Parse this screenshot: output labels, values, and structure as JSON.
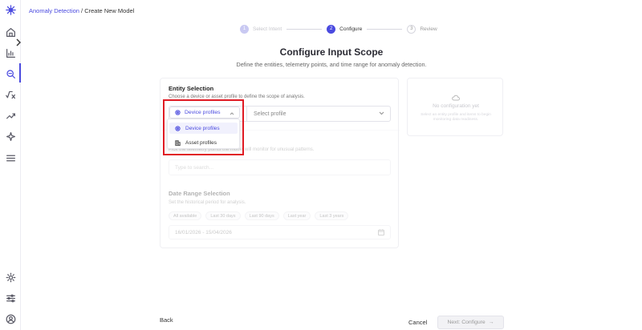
{
  "breadcrumb": {
    "parent": "Anomaly Detection",
    "separator": " / ",
    "current": "Create New Model"
  },
  "stepper": {
    "steps": [
      {
        "num": "1",
        "label": "Select Intent"
      },
      {
        "num": "2",
        "label": "Configure"
      },
      {
        "num": "3",
        "label": "Review"
      }
    ]
  },
  "header": {
    "title": "Configure Input Scope",
    "subtitle": "Define the entities, telemetry points, and time range for anomaly detection."
  },
  "entity": {
    "title": "Entity Selection",
    "description": "Choose a device or asset profile to define the scope of analysis.",
    "type_selected": "Device profiles",
    "profile_placeholder": "Select profile",
    "options": [
      "Device profiles",
      "Asset profiles"
    ]
  },
  "telemetry": {
    "description": "Pick the telemetry points the model will monitor for unusual patterns.",
    "search_placeholder": "Type to search..."
  },
  "daterange": {
    "title": "Date Range Selection",
    "description": "Set the historical period for analysis.",
    "presets": [
      "All available",
      "Last 30 days",
      "Last 90 days",
      "Last year",
      "Last 3 years"
    ],
    "value": "16/01/2026 - 15/04/2026"
  },
  "side_panel": {
    "title": "No configuration yet",
    "description": "Select an entity profile and items to begin monitoring data readiness."
  },
  "footer": {
    "back": "Back",
    "cancel": "Cancel",
    "next": "Next: Configure",
    "next_arrow": "→"
  },
  "colors": {
    "accent": "#4a4adf",
    "highlight": "#e01b24"
  }
}
